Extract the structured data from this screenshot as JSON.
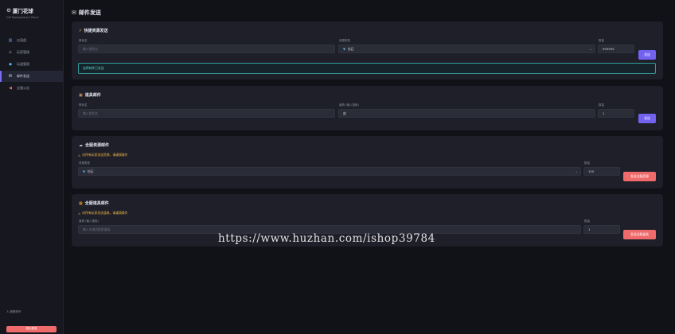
{
  "sidebar": {
    "title": "厦门花球",
    "subtitle": "GM Management Panel",
    "items": [
      {
        "label": "仪表盘",
        "icon": "chart-icon"
      },
      {
        "label": "玩家管理",
        "icon": "user-icon"
      },
      {
        "label": "玩道管理",
        "icon": "diamond-icon"
      },
      {
        "label": "邮件发送",
        "icon": "mail-icon"
      },
      {
        "label": "全服公告",
        "icon": "megaphone-icon"
      }
    ],
    "user": "超管账号",
    "logout": "退出登录"
  },
  "page": {
    "title": "邮件发送"
  },
  "quick_send": {
    "title": "快捷资源发送",
    "player_label": "角色名",
    "player_placeholder": "输入角色名",
    "type_label": "资源类型",
    "type_value": "钻石",
    "qty_label": "数量",
    "qty_value": "999999",
    "button": "发送",
    "status": "选择邮件已发送"
  },
  "item_mail": {
    "title": "道具邮件",
    "player_label": "角色名",
    "player_placeholder": "输入角色名",
    "item_label": "道具 (输入搜索)",
    "item_value": "皮",
    "qty_label": "数量",
    "qty_value": "1",
    "button": "发送"
  },
  "global_resource": {
    "title": "全服资源邮件",
    "warning": "向所有玩家发送资源，请谨慎操作",
    "type_label": "资源类型",
    "type_value": "钻石",
    "qty_label": "数量",
    "qty_value": "100",
    "button": "发送全服资源"
  },
  "global_item": {
    "title": "全服道具邮件",
    "warning": "向所有玩家发送道具，请谨慎操作",
    "item_label": "道具 (输入搜索)",
    "item_placeholder": "输入关键词搜索道具...",
    "qty_label": "数量",
    "qty_value": "1",
    "button": "发送全服道具"
  },
  "watermark": "https://www.huzhan.com/ishop39784"
}
